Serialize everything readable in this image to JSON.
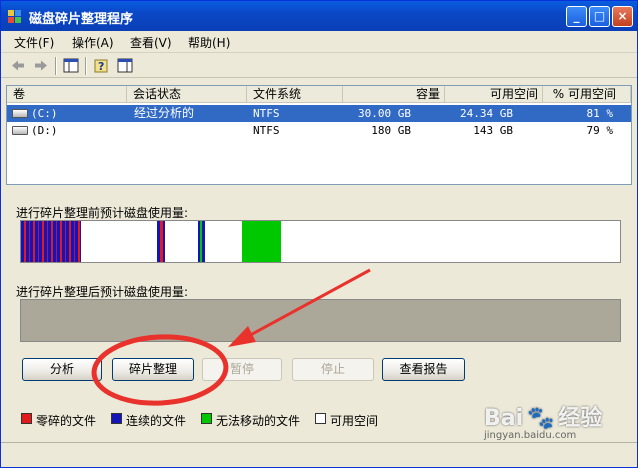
{
  "window": {
    "title": "磁盘碎片整理程序",
    "caption_buttons": {
      "minimize": "_",
      "maximize": "□",
      "close": "×"
    }
  },
  "menu": [
    "文件(F)",
    "操作(A)",
    "查看(V)",
    "帮助(H)"
  ],
  "toolbar": {
    "icons": [
      "back-arrow-icon",
      "forward-arrow-icon",
      "console-tree-icon",
      "help-icon",
      "properties-icon"
    ]
  },
  "volumes": {
    "columns": [
      "卷",
      "会话状态",
      "文件系统",
      "容量",
      "可用空间",
      "% 可用空间"
    ],
    "rows": [
      {
        "volume": "(C:)",
        "status": "经过分析的",
        "fs": "NTFS",
        "capacity": "30.00 GB",
        "free": "24.34 GB",
        "pct_free": "81 %",
        "selected": true
      },
      {
        "volume": "(D:)",
        "status": "",
        "fs": "NTFS",
        "capacity": "180 GB",
        "free": "143 GB",
        "pct_free": "79 %",
        "selected": false
      }
    ]
  },
  "usage": {
    "before_label": "进行碎片整理前预计磁盘使用量:",
    "after_label": "进行碎片整理后预计磁盘使用量:",
    "colors": {
      "fragmented": "#e11b1b",
      "contiguous": "#1414b8",
      "unmovable": "#00c800",
      "free": "#ffffff"
    }
  },
  "buttons": {
    "analyze": "分析",
    "defragment": "碎片整理",
    "pause": "暂停",
    "stop": "停止",
    "view_report": "查看报告"
  },
  "legend": [
    {
      "label": "零碎的文件",
      "color": "#e11b1b"
    },
    {
      "label": "连续的文件",
      "color": "#1414b8"
    },
    {
      "label": "无法移动的文件",
      "color": "#00c800"
    },
    {
      "label": "可用空间",
      "color": "#ffffff"
    }
  ],
  "watermark": {
    "brand": "Bai",
    "suffix": "经验",
    "url": "jingyan.baidu.com"
  }
}
